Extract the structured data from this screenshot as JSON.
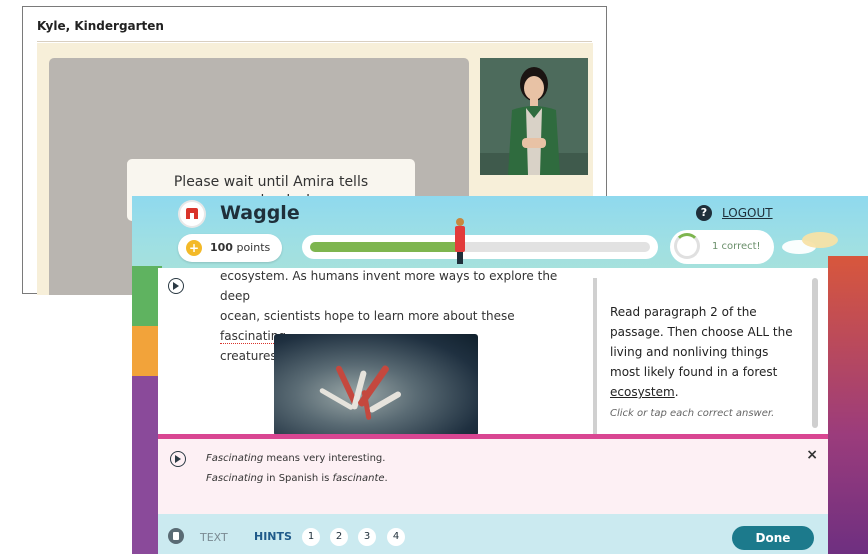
{
  "back_window": {
    "title": "Kyle, Kindergarten",
    "wait_message": "Please wait until Amira tells you to start"
  },
  "app": {
    "name": "Waggle",
    "logout": "LOGOUT",
    "help_icon": "?",
    "points_value": "100",
    "points_unit": "points",
    "progress_fraction": 0.44,
    "correct_label": "1 correct!"
  },
  "passage": {
    "line1": "ecosystem. As humans invent more ways to explore the deep",
    "line2_pre": "ocean, scientists hope to learn more about these ",
    "line2_keyword": "fascinating",
    "line3": "creatures."
  },
  "prompt": {
    "text_pre": "Read paragraph 2 of the passage. Then choose ALL the living and nonliving things most likely found in a forest ",
    "text_keyword": "ecosystem",
    "text_post": ".",
    "hint": "Click or tap each correct answer."
  },
  "glossary": {
    "term": "Fascinating",
    "definition": " means very interesting.",
    "spanish_intro": " in Spanish is ",
    "spanish_word": "fascinante",
    "spanish_end": ".",
    "close": "×"
  },
  "bottom_bar": {
    "text_label": "TEXT",
    "hints_label": "HINTS",
    "hints": [
      "1",
      "2",
      "3",
      "4"
    ],
    "done": "Done"
  },
  "colors": {
    "accent_pink": "#d94692",
    "done_teal": "#1c7a8c",
    "progress_green": "#7eb54f",
    "coin_gold": "#f3b928"
  }
}
